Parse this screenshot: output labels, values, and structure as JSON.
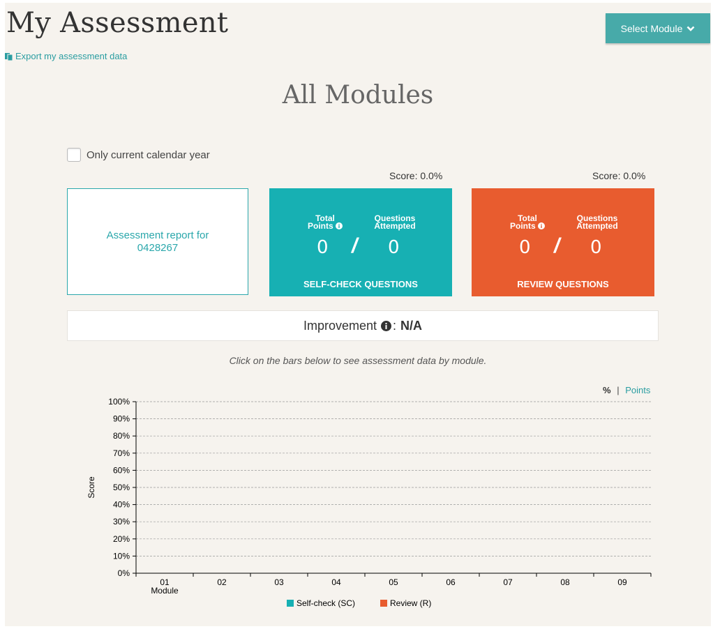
{
  "header": {
    "title": "My Assessment",
    "export_label": "Export my assessment data",
    "select_module_label": "Select Module"
  },
  "module_heading": "All Modules",
  "filter": {
    "current_year_label": "Only current calendar year"
  },
  "report_box": {
    "text": "Assessment report for 0428267"
  },
  "self_check": {
    "score": "Score: 0.0%",
    "total_points_label": "Total Points",
    "questions_label": "Questions Attempted",
    "total_points": "0",
    "separator": "/",
    "questions_attempted": "0",
    "caption": "SELF-CHECK QUESTIONS",
    "color": "#17b0b3"
  },
  "review": {
    "score": "Score: 0.0%",
    "total_points_label": "Total Points",
    "questions_label": "Questions Attempted",
    "total_points": "0",
    "separator": "/",
    "questions_attempted": "0",
    "caption": "REVIEW QUESTIONS",
    "color": "#e85c2f"
  },
  "improvement": {
    "label": "Improvement",
    "value": "N/A"
  },
  "hint": "Click on the bars below to see assessment data by module.",
  "view_toggle": {
    "percent": "%",
    "separator": "|",
    "points": "Points"
  },
  "icons": [
    "export-icon",
    "chevron-down-icon",
    "info-icon",
    "checkbox-icon"
  ],
  "chart_data": {
    "type": "bar",
    "ylabel": "Score",
    "xlabel": "Module",
    "ylim": [
      0,
      100
    ],
    "y_ticks": [
      "0%",
      "10%",
      "20%",
      "30%",
      "40%",
      "50%",
      "60%",
      "70%",
      "80%",
      "90%",
      "100%"
    ],
    "categories": [
      "01",
      "02",
      "03",
      "04",
      "05",
      "06",
      "07",
      "08",
      "09"
    ],
    "series": [
      {
        "name": "Self-check (SC)",
        "color": "#17b0b3",
        "values": [
          0,
          0,
          0,
          0,
          0,
          0,
          0,
          0,
          0
        ]
      },
      {
        "name": "Review (R)",
        "color": "#e85c2f",
        "values": [
          0,
          0,
          0,
          0,
          0,
          0,
          0,
          0,
          0
        ]
      }
    ],
    "grid": true,
    "legend_position": "bottom"
  }
}
